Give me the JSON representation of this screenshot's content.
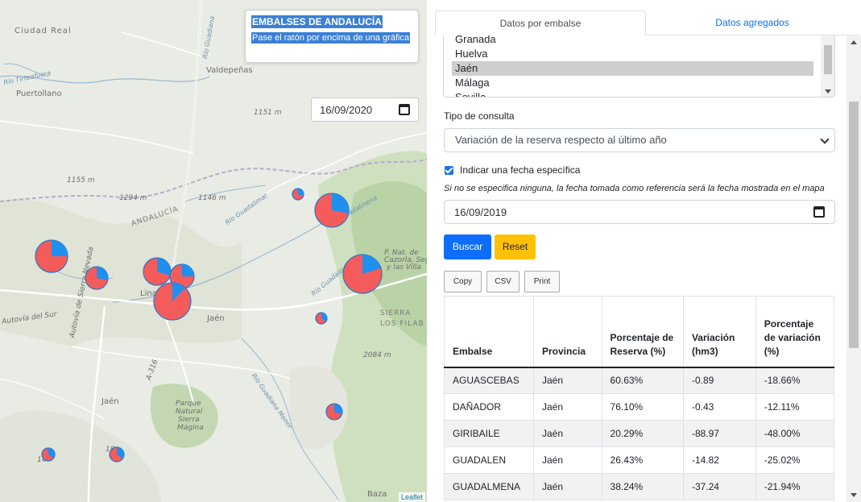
{
  "map": {
    "labels": {
      "ciudad_real": "Ciudad Real",
      "puertollano": "Puertollano",
      "valdepenas": "Valdepeñas",
      "andalucia": "ANDALUCÍA",
      "linares": "Lina",
      "jaen_city": "Jaén",
      "jaen_region": "Jaén",
      "baza": "Baza",
      "sierra": "SIERRA",
      "los_filab": "LOS FILAB",
      "parque": "Parque",
      "natural": "Natural",
      "sierra_m": "Sierra",
      "magina": "Mágina",
      "pnat1": "P. Nat. de",
      "pnat2": "Cazorla, Seg",
      "pnat3": "y las Villa",
      "elev_1151": "1151 m",
      "elev_1155": "1155 m",
      "elev_1294": "1294 m",
      "elev_1146": "1146 m",
      "elev_2084": "2084 m",
      "elev_14": "14",
      "elev_18": "18",
      "autovia_sur": "Autovía del Sur",
      "autovia_sn": "Autovía de Sierra Nevada",
      "a316": "A-316",
      "rio_guadiana": "Rio Guadiana",
      "rio_gualdalimar": "Río Guadalimar",
      "rio_guadalquivir": "Río Guadalquivir",
      "rio_guadiana_menor": "Río Guadiana Menor",
      "rio_tirteafuera": "Río Tirteafuera",
      "guadalmena": "Guadalmena"
    },
    "info_title": "EMBALSES DE ANDALUCÍA",
    "info_hint": "Pase el ratón por encima de una gráfica",
    "date": "16/09/2020",
    "attribution": "Leaflet",
    "colors": {
      "pie_red": "#f45b5b",
      "pie_blue": "#1f8ff0",
      "pie_stroke": "#2a75c9"
    }
  },
  "tabs": {
    "active": "Datos por embalse",
    "other": "Datos agregados"
  },
  "province_list": {
    "options": [
      "Granada",
      "Huelva",
      "Jaén",
      "Málaga",
      "Sevilla"
    ],
    "selected": "Jaén"
  },
  "query": {
    "label": "Tipo de consulta",
    "value": "Variación de la reserva respecto al último año"
  },
  "specific_date": {
    "label": "Indicar una fecha específica",
    "checked": true,
    "note": "Si no se especifica ninguna, la fecha tomada como referencia será la fecha mostrada en el mapa",
    "value": "16/09/2019"
  },
  "buttons": {
    "search": "Buscar",
    "reset": "Reset"
  },
  "table_tools": {
    "copy": "Copy",
    "csv": "CSV",
    "print": "Print"
  },
  "table": {
    "headers": [
      "Embalse",
      "Provincia",
      "Porcentaje de Reserva (%)",
      "Variación (hm3)",
      "Porcentaje de variación (%)"
    ],
    "rows": [
      [
        "AGUASCEBAS",
        "Jaén",
        "60.63%",
        "-0.89",
        "-18.66%"
      ],
      [
        "DAÑADOR",
        "Jaén",
        "76.10%",
        "-0.43",
        "-12.11%"
      ],
      [
        "GIRIBAILE",
        "Jaén",
        "20.29%",
        "-88.97",
        "-48.00%"
      ],
      [
        "GUADALEN",
        "Jaén",
        "26.43%",
        "-14.82",
        "-25.02%"
      ],
      [
        "GUADALMENA",
        "Jaén",
        "38.24%",
        "-37.24",
        "-21.94%"
      ]
    ]
  }
}
